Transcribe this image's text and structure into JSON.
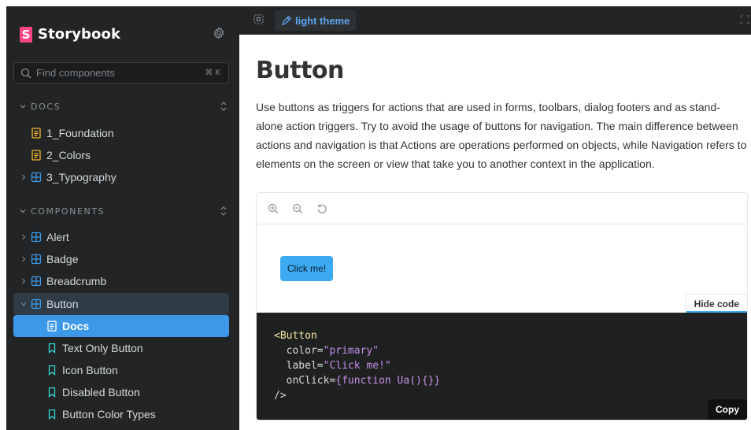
{
  "sidebar": {
    "brand": "Storybook",
    "search_placeholder": "Find components",
    "search_shortcut": "⌘ K",
    "docs_section": "DOCS",
    "docs_items": [
      {
        "label": "1_Foundation",
        "icon": "document-icon"
      },
      {
        "label": "2_Colors",
        "icon": "document-icon"
      },
      {
        "label": "3_Typography",
        "icon": "component-icon"
      }
    ],
    "components_section": "COMPONENTS",
    "component_items": [
      {
        "label": "Alert"
      },
      {
        "label": "Badge"
      },
      {
        "label": "Breadcrumb"
      },
      {
        "label": "Button"
      }
    ],
    "button_children": [
      {
        "label": "Docs",
        "icon": "document-icon"
      },
      {
        "label": "Text Only Button",
        "icon": "bookmark-icon"
      },
      {
        "label": "Icon Button",
        "icon": "bookmark-icon"
      },
      {
        "label": "Disabled Button",
        "icon": "bookmark-icon"
      },
      {
        "label": "Button Color Types",
        "icon": "bookmark-icon"
      }
    ]
  },
  "toolbar": {
    "theme_label": "light theme"
  },
  "main": {
    "title": "Button",
    "description": "Use buttons as triggers for actions that are used in forms, toolbars, dialog footers and as stand-alone action triggers. Try to avoid the usage of buttons for navigation. The main difference between actions and navigation is that Actions are operations performed on objects, while Navigation refers to elements on the screen or view that take you to another context in the application.",
    "preview_button": "Click me!",
    "hide_code": "Hide code",
    "copy": "Copy",
    "code": {
      "open_tag": "<Button",
      "attr1_name": "color=",
      "attr1_value": "\"primary\"",
      "attr2_name": "label=",
      "attr2_value": "\"Click me!\"",
      "attr3_name": "onClick=",
      "attr3_value": "{function Ua(){}}",
      "close_tag": "/>"
    }
  },
  "colors": {
    "accent": "#3b99e8",
    "sidebar_bg": "#222425",
    "brand_pink": "#ff4785",
    "doc_icon": "#f5b72a",
    "component_icon": "#3b99e8",
    "story_icon": "#37d5d3"
  }
}
